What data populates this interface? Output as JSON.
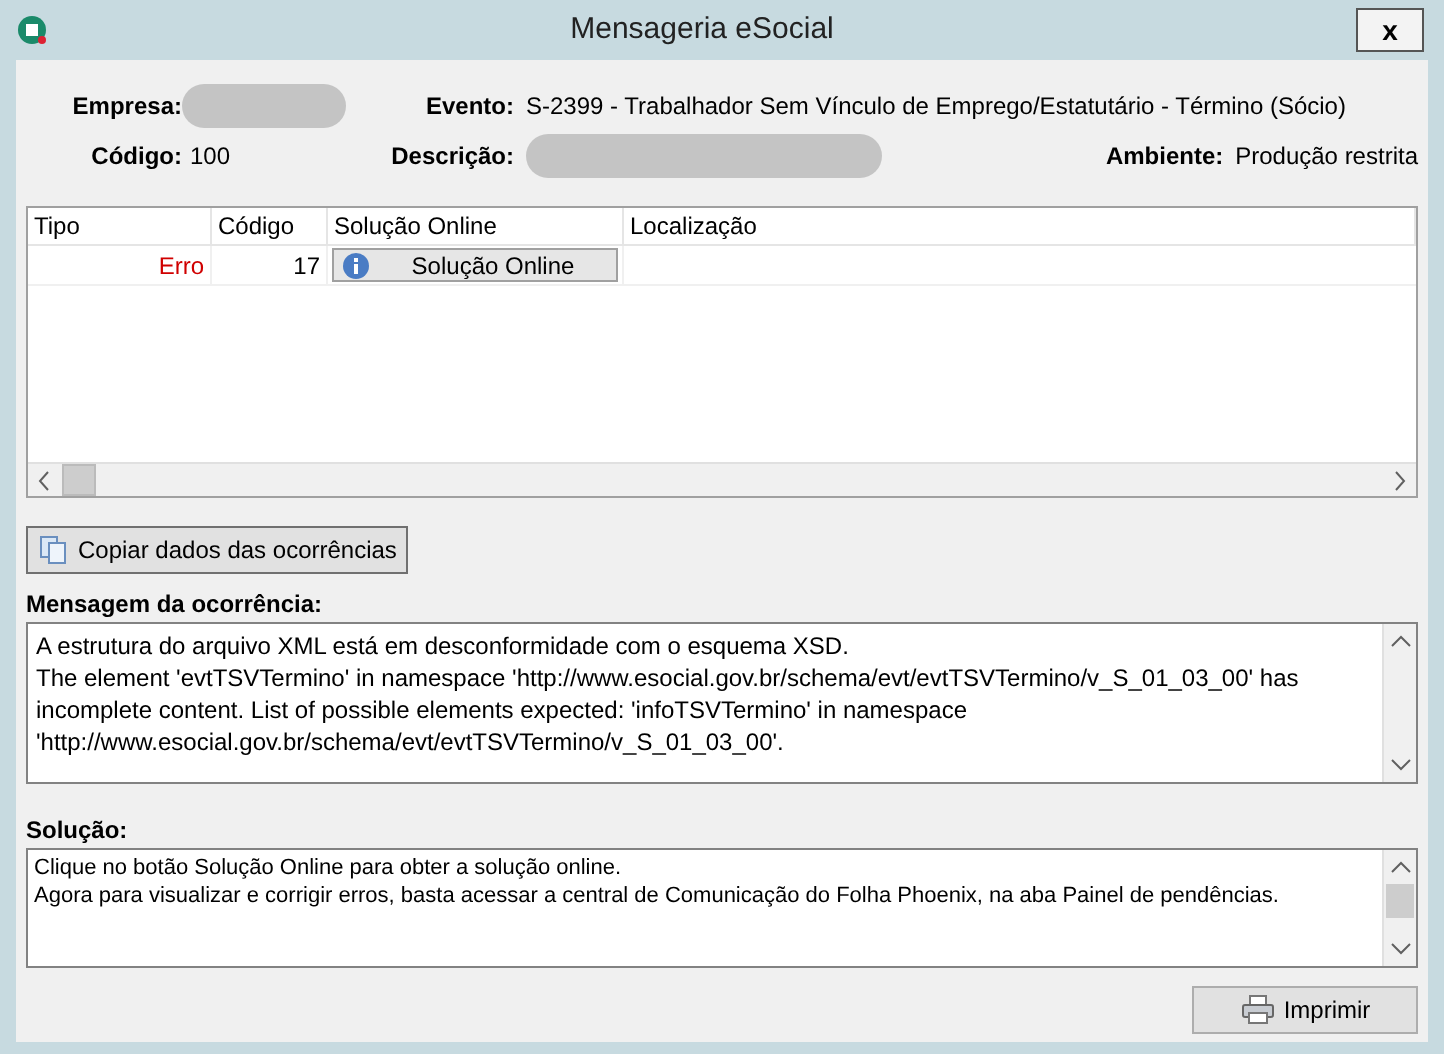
{
  "window": {
    "title": "Mensageria eSocial",
    "close": "x"
  },
  "header": {
    "empresa_label": "Empresa:",
    "evento_label": "Evento:",
    "evento": "S-2399 - Trabalhador Sem Vínculo de Emprego/Estatutário - Término (Sócio)",
    "codigo_label": "Código:",
    "codigo": "100",
    "descricao_label": "Descrição:",
    "ambiente_label": "Ambiente:",
    "ambiente": "Produção restrita"
  },
  "table": {
    "columns": [
      "Tipo",
      "Código",
      "Solução Online",
      "Localização"
    ],
    "rows": [
      {
        "tipo": "Erro",
        "codigo": "17",
        "solucao": "Solução Online",
        "localizacao": ""
      }
    ]
  },
  "copy_button": "Copiar dados das ocorrências",
  "message": {
    "label": "Mensagem da ocorrência:",
    "lines": [
      "A estrutura do arquivo XML está em desconformidade com o esquema XSD.",
      "The element 'evtTSVTermino' in namespace 'http://www.esocial.gov.br/schema/evt/evtTSVTermino/v_S_01_03_00' has incomplete content. List of possible elements expected: 'infoTSVTermino' in namespace 'http://www.esocial.gov.br/schema/evt/evtTSVTermino/v_S_01_03_00'."
    ]
  },
  "solution": {
    "label": "Solução:",
    "lines": [
      "Clique no botão Solução Online para obter a solução online.",
      "Agora para visualizar e corrigir erros, basta acessar a central de Comunicação do Folha Phoenix, na aba Painel de pendências."
    ]
  },
  "print_button": "Imprimir"
}
